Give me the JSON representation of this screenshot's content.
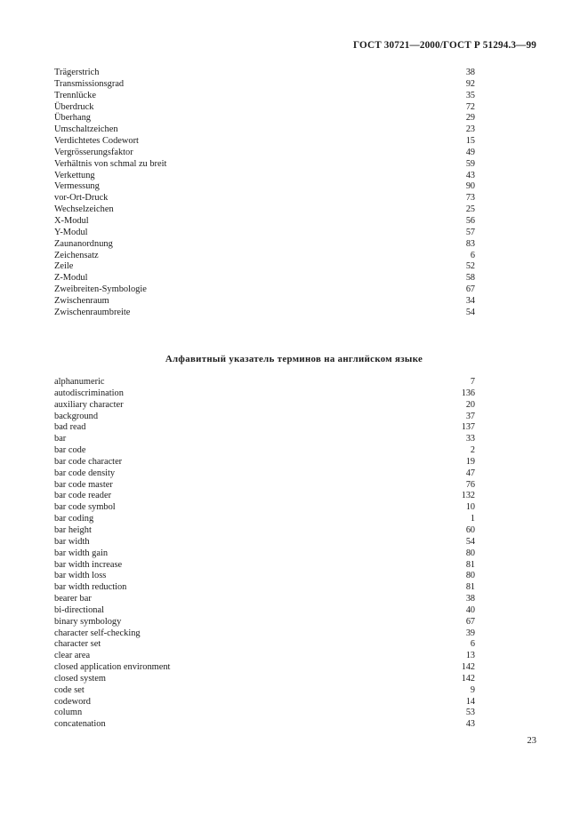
{
  "document": {
    "running_header": "ГОСТ 30721—2000/ГОСТ Р 51294.3—99",
    "folio": "23"
  },
  "german_index": {
    "entries": [
      {
        "term": "Trägerstrich",
        "page": "38"
      },
      {
        "term": "Transmissionsgrad",
        "page": "92"
      },
      {
        "term": "Trennlücke",
        "page": "35"
      },
      {
        "term": "Überdruck",
        "page": "72"
      },
      {
        "term": "Überhang",
        "page": "29"
      },
      {
        "term": "Umschaltzeichen",
        "page": "23"
      },
      {
        "term": "Verdichtetes Codewort",
        "page": "15"
      },
      {
        "term": "Vergrösserungsfaktor",
        "page": "49"
      },
      {
        "term": "Verhältnis von schmal zu breit",
        "page": "59"
      },
      {
        "term": "Verkettung",
        "page": "43"
      },
      {
        "term": "Vermessung",
        "page": "90"
      },
      {
        "term": "vor-Ort-Druck",
        "page": "73"
      },
      {
        "term": "Wechselzeichen",
        "page": "25"
      },
      {
        "term": "X-Modul",
        "page": "56"
      },
      {
        "term": "Y-Modul",
        "page": "57"
      },
      {
        "term": "Zaunanordnung",
        "page": "83"
      },
      {
        "term": "Zeichensatz",
        "page": "6"
      },
      {
        "term": "Zeile",
        "page": "52"
      },
      {
        "term": "Z-Modul",
        "page": "58"
      },
      {
        "term": "Zweibreiten-Symbologie",
        "page": "67"
      },
      {
        "term": "Zwischenraum",
        "page": "34"
      },
      {
        "term": "Zwischenraumbreite",
        "page": "54"
      }
    ]
  },
  "english_index": {
    "heading": "Алфавитный указатель терминов на английском языке",
    "entries": [
      {
        "term": "alphanumeric",
        "page": "7"
      },
      {
        "term": "autodiscrimination",
        "page": "136"
      },
      {
        "term": "auxiliary character",
        "page": "20"
      },
      {
        "term": "background",
        "page": "37"
      },
      {
        "term": "bad read",
        "page": "137"
      },
      {
        "term": "bar",
        "page": "33"
      },
      {
        "term": "bar code",
        "page": "2"
      },
      {
        "term": "bar code character",
        "page": "19"
      },
      {
        "term": "bar code density",
        "page": "47"
      },
      {
        "term": "bar code master",
        "page": "76"
      },
      {
        "term": "bar code reader",
        "page": "132"
      },
      {
        "term": "bar code symbol",
        "page": "10"
      },
      {
        "term": "bar coding",
        "page": "1"
      },
      {
        "term": "bar height",
        "page": "60"
      },
      {
        "term": "bar width",
        "page": "54"
      },
      {
        "term": "bar width gain",
        "page": "80"
      },
      {
        "term": "bar width increase",
        "page": "81"
      },
      {
        "term": "bar width loss",
        "page": "80"
      },
      {
        "term": "bar width reduction",
        "page": "81"
      },
      {
        "term": "bearer bar",
        "page": "38"
      },
      {
        "term": "bi-directional",
        "page": "40"
      },
      {
        "term": "binary symbology",
        "page": "67"
      },
      {
        "term": "character self-checking",
        "page": "39"
      },
      {
        "term": "character set",
        "page": "6"
      },
      {
        "term": "clear area",
        "page": "13"
      },
      {
        "term": "closed application environment",
        "page": "142"
      },
      {
        "term": "closed system",
        "page": "142"
      },
      {
        "term": "code set",
        "page": "9"
      },
      {
        "term": "codeword",
        "page": "14"
      },
      {
        "term": "column",
        "page": "53"
      },
      {
        "term": "concatenation",
        "page": "43"
      }
    ]
  }
}
